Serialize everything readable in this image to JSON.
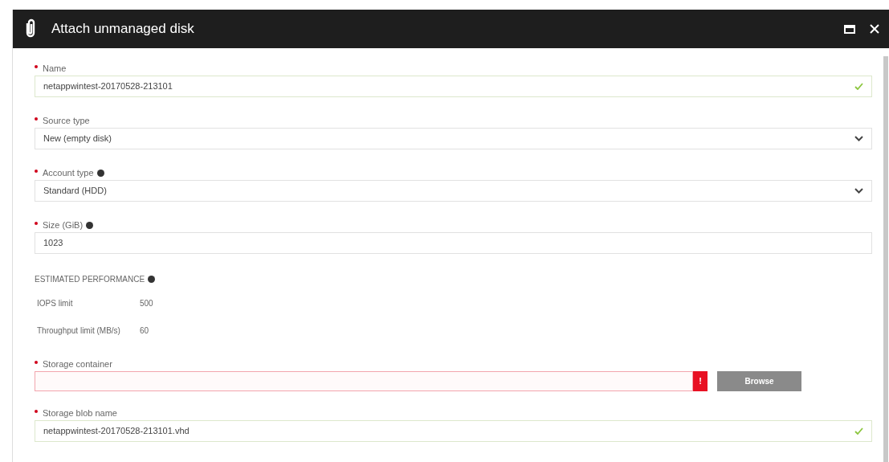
{
  "window": {
    "title": "Attach unmanaged disk"
  },
  "fields_top": [
    {
      "kind": "text",
      "label": "Name",
      "required": true,
      "info": false,
      "value": "netappwintest-20170528-213101",
      "valid": true
    },
    {
      "kind": "select",
      "label": "Source type",
      "required": true,
      "info": false,
      "value": "New (empty disk)",
      "valid": false
    },
    {
      "kind": "select",
      "label": "Account type",
      "required": true,
      "info": true,
      "value": "Standard (HDD)",
      "valid": false
    },
    {
      "kind": "text",
      "label": "Size (GiB)",
      "required": true,
      "info": true,
      "value": "1023",
      "valid": false
    }
  ],
  "performance": {
    "heading": "ESTIMATED PERFORMANCE",
    "info": true,
    "rows": [
      {
        "label": "IOPS limit",
        "value": "500"
      },
      {
        "label": "Throughput limit (MB/s)",
        "value": "60"
      }
    ]
  },
  "storage_container": {
    "label": "Storage container",
    "required": true,
    "error": true,
    "error_mark": "!",
    "button": {
      "label": "Browse",
      "disabled": true
    }
  },
  "storage_blob": {
    "label": "Storage blob name",
    "required": true,
    "value": "netappwintest-20170528-213101.vhd",
    "valid": true
  }
}
